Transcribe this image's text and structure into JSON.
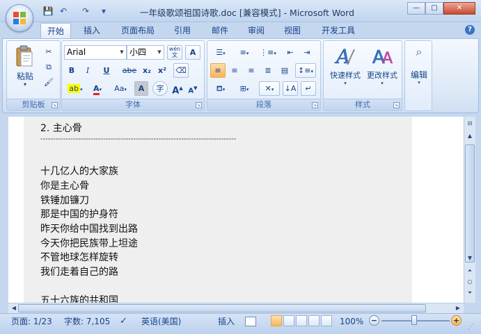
{
  "window": {
    "title": "一年级歌颂祖国诗歌.doc [兼容模式] - Microsoft Word",
    "minimize": "—",
    "maximize": "□",
    "close": "✕"
  },
  "qat": {
    "save_icon": "💾",
    "undo_icon": "↶",
    "redo_icon": "↷",
    "more_icon": "▾"
  },
  "tabs": [
    "开始",
    "插入",
    "页面布局",
    "引用",
    "邮件",
    "审阅",
    "视图",
    "开发工具"
  ],
  "help": "?",
  "ribbon": {
    "clipboard": {
      "label": "剪贴板",
      "paste": "粘贴"
    },
    "font": {
      "label": "字体",
      "font_name": "Arial",
      "font_size": "小四",
      "wen": "wén",
      "bold": "B",
      "italic": "I",
      "underline": "U",
      "strike": "abe",
      "subscript": "x₂",
      "superscript": "x²",
      "change_case": "Aa",
      "char_shading": "A",
      "enclose": "字",
      "grow": "A",
      "shrink": "A"
    },
    "paragraph": {
      "label": "段落"
    },
    "styles": {
      "label": "样式",
      "quick": "快速样式",
      "change": "更改样式"
    },
    "editing": {
      "label": "编辑"
    }
  },
  "document": {
    "lines": [
      "2.  主心骨",
      "------------------------------------------------------------------------------",
      "",
      "十几亿人的大家族",
      "你是主心骨",
      "铁锤加镰刀",
      "那是中国的护身符",
      "昨天你给中国找到出路",
      "今天你把民族带上坦途",
      "不管地球怎样旋转",
      "我们走着自己的路",
      "",
      "五十六族的共和国"
    ]
  },
  "statusbar": {
    "page": "页面: 1/23",
    "words": "字数: 7,105",
    "language": "英语(美国)",
    "insert": "插入",
    "zoom": "100%"
  },
  "colors": {
    "accent": "#15428b",
    "ribbon_bg": "#dde9f7",
    "highlight": "#f9b55a"
  }
}
